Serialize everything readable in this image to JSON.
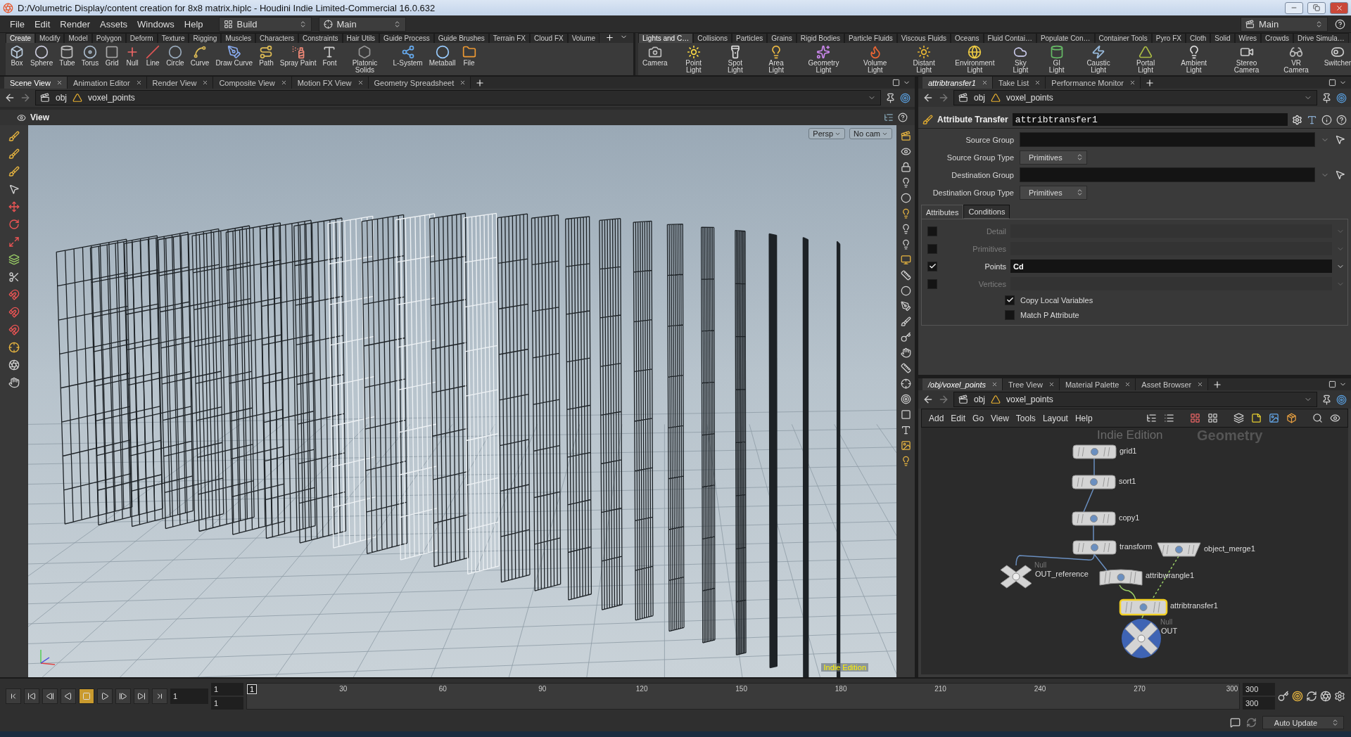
{
  "window": {
    "title": "D:/Volumetric Display/content creation for 8x8 matrix.hiplc - Houdini Indie Limited-Commercial 16.0.632"
  },
  "menu": [
    "File",
    "Edit",
    "Render",
    "Assets",
    "Windows",
    "Help"
  ],
  "desktop": "Build",
  "context": "Main",
  "right_desktop": "Main",
  "shelf_left": {
    "tabs": [
      {
        "label": "Create",
        "selected": true
      },
      {
        "label": "Modify",
        "selected": false
      },
      {
        "label": "Model",
        "selected": false
      },
      {
        "label": "Polygon",
        "selected": false
      },
      {
        "label": "Deform",
        "selected": false
      },
      {
        "label": "Texture",
        "selected": false
      },
      {
        "label": "Rigging",
        "selected": false
      },
      {
        "label": "Muscles",
        "selected": false
      },
      {
        "label": "Characters",
        "selected": false
      },
      {
        "label": "Constraints",
        "selected": false
      },
      {
        "label": "Hair Utils",
        "selected": false
      },
      {
        "label": "Guide Process",
        "selected": false
      },
      {
        "label": "Guide Brushes",
        "selected": false
      },
      {
        "label": "Terrain FX",
        "selected": false
      },
      {
        "label": "Cloud FX",
        "selected": false
      },
      {
        "label": "Volume",
        "selected": false
      }
    ],
    "tools": [
      "Box",
      "Sphere",
      "Tube",
      "Torus",
      "Grid",
      "Null",
      "Line",
      "Circle",
      "Curve",
      "Draw Curve",
      "Path",
      "Spray Paint",
      "Font",
      "Platonic Solids",
      "L-System",
      "Metaball",
      "File"
    ]
  },
  "shelf_right": {
    "tabs": [
      {
        "label": "Lights and C…",
        "selected": true
      },
      {
        "label": "Collisions",
        "selected": false
      },
      {
        "label": "Particles",
        "selected": false
      },
      {
        "label": "Grains",
        "selected": false
      },
      {
        "label": "Rigid Bodies",
        "selected": false
      },
      {
        "label": "Particle Fluids",
        "selected": false
      },
      {
        "label": "Viscous Fluids",
        "selected": false
      },
      {
        "label": "Oceans",
        "selected": false
      },
      {
        "label": "Fluid Contai…",
        "selected": false
      },
      {
        "label": "Populate Con…",
        "selected": false
      },
      {
        "label": "Container Tools",
        "selected": false
      },
      {
        "label": "Pyro FX",
        "selected": false
      },
      {
        "label": "Cloth",
        "selected": false
      },
      {
        "label": "Solid",
        "selected": false
      },
      {
        "label": "Wires",
        "selected": false
      },
      {
        "label": "Crowds",
        "selected": false
      },
      {
        "label": "Drive Simula…",
        "selected": false
      }
    ],
    "tools": [
      "Camera",
      "Point Light",
      "Spot Light",
      "Area Light",
      "Geometry Light",
      "Volume Light",
      "Distant Light",
      "Environment Light",
      "Sky Light",
      "GI Light",
      "Caustic Light",
      "Portal Light",
      "Ambient Light",
      "Stereo Camera",
      "VR Camera",
      "Switcher"
    ]
  },
  "scene_pane": {
    "tabs": [
      {
        "label": "Scene View",
        "selected": true
      },
      {
        "label": "Animation Editor",
        "selected": false
      },
      {
        "label": "Render View",
        "selected": false
      },
      {
        "label": "Composite View",
        "selected": false
      },
      {
        "label": "Motion FX View",
        "selected": false
      },
      {
        "label": "Geometry Spreadsheet",
        "selected": false
      }
    ],
    "path": [
      "obj",
      "voxel_points"
    ],
    "viewport": {
      "title": "View",
      "camera": "Persp",
      "cam": "No cam",
      "edition": "Indie Edition"
    }
  },
  "param_pane": {
    "tabs": [
      {
        "label": "attribtransfer1",
        "selected": true
      },
      {
        "label": "Take List",
        "selected": false
      },
      {
        "label": "Performance Monitor",
        "selected": false
      }
    ],
    "path": [
      "obj",
      "voxel_points"
    ],
    "node_type": "Attribute Transfer",
    "node_name": "attribtransfer1",
    "fields": [
      {
        "label": "Source Group",
        "kind": "group"
      },
      {
        "label": "Source Group Type",
        "kind": "menu",
        "value": "Primitives"
      },
      {
        "label": "Destination Group",
        "kind": "group"
      },
      {
        "label": "Destination Group Type",
        "kind": "menu",
        "value": "Primitives"
      }
    ],
    "subtabs": [
      {
        "label": "Attributes",
        "selected": true
      },
      {
        "label": "Conditions",
        "selected": false
      }
    ],
    "attributes": [
      {
        "label": "Detail",
        "checked": false
      },
      {
        "label": "Primitives",
        "checked": false
      },
      {
        "label": "Points",
        "checked": true,
        "value": "Cd"
      },
      {
        "label": "Vertices",
        "checked": false
      }
    ],
    "toggles": [
      {
        "label": "Copy Local Variables",
        "checked": true
      },
      {
        "label": "Match P Attribute",
        "checked": false
      }
    ]
  },
  "network_pane": {
    "tabs": [
      {
        "label": "/obj/voxel_points",
        "selected": true
      },
      {
        "label": "Tree View",
        "selected": false
      },
      {
        "label": "Material Palette",
        "selected": false
      },
      {
        "label": "Asset Browser",
        "selected": false
      }
    ],
    "path": [
      "obj",
      "voxel_points"
    ],
    "menu": [
      "Add",
      "Edit",
      "Go",
      "View",
      "Tools",
      "Layout",
      "Help"
    ],
    "edition": "Indie Edition",
    "context": "Geometry",
    "nodes": [
      {
        "name": "grid1",
        "kind": "sop",
        "selected": false,
        "display": false
      },
      {
        "name": "sort1",
        "kind": "sop",
        "selected": false,
        "display": false
      },
      {
        "name": "copy1",
        "kind": "sop",
        "selected": false,
        "display": false
      },
      {
        "name": "transform",
        "kind": "sop",
        "selected": false,
        "display": false
      },
      {
        "name": "object_merge1",
        "kind": "merge",
        "selected": false,
        "display": false
      },
      {
        "name": "OUT_reference",
        "kind": "null",
        "type_label": "Null",
        "selected": false,
        "display": false
      },
      {
        "name": "attribwrangle1",
        "kind": "wrangle",
        "selected": false,
        "display": false
      },
      {
        "name": "attribtransfer1",
        "kind": "sop",
        "selected": true,
        "display": false
      },
      {
        "name": "OUT",
        "kind": "null",
        "type_label": "Null",
        "selected": false,
        "display": true
      }
    ]
  },
  "timeline": {
    "frame": "1",
    "start": "1",
    "range_start": "1",
    "marker": "1",
    "ticks": [
      "30",
      "60",
      "90",
      "120",
      "150",
      "180",
      "210",
      "240",
      "270",
      "300"
    ],
    "end": "300",
    "range_end": "300"
  },
  "status_bar": {
    "update": "Auto Update"
  }
}
